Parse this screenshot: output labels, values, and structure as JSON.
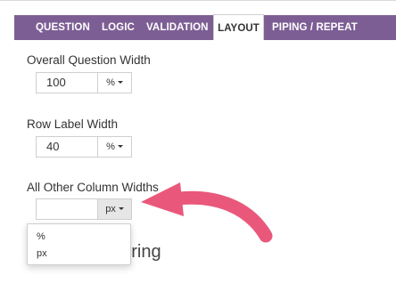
{
  "tabs": [
    {
      "label": "QUESTION"
    },
    {
      "label": "LOGIC"
    },
    {
      "label": "VALIDATION"
    },
    {
      "label": "LAYOUT",
      "active": true
    },
    {
      "label": "PIPING / REPEAT"
    }
  ],
  "overall_width": {
    "label": "Overall Question Width",
    "value": "100",
    "unit": "%"
  },
  "row_label_width": {
    "label": "Row Label Width",
    "value": "40",
    "unit": "%"
  },
  "other_widths": {
    "label": "All Other Column Widths",
    "value": "",
    "unit": "px"
  },
  "unit_dropdown": {
    "options": [
      "%",
      "px"
    ]
  },
  "section_heading_partial": "bering",
  "colors": {
    "tab_bar": "#7d5e94",
    "arrow": "#e9587a"
  }
}
